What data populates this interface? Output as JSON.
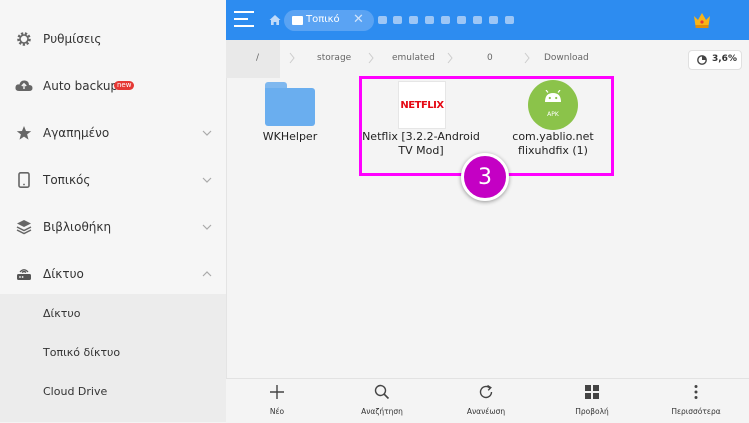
{
  "sidebar": {
    "items": [
      {
        "label": "Ρυθμίσεις"
      },
      {
        "label": "Auto backup",
        "badge": "new"
      },
      {
        "label": "Αγαπημένο"
      },
      {
        "label": "Τοπικός"
      },
      {
        "label": "Βιβλιοθήκη"
      },
      {
        "label": "Δίκτυο"
      }
    ],
    "subitems": [
      {
        "label": "Δίκτυο"
      },
      {
        "label": "Τοπικό δίκτυο"
      },
      {
        "label": "Cloud Drive"
      }
    ]
  },
  "topbar": {
    "active_tab": "Τοπικό",
    "close_glyph": "✕"
  },
  "pathbar": {
    "crumbs": [
      "/",
      "storage",
      "emulated",
      "0",
      "Download"
    ],
    "usage": "3,6%"
  },
  "files": [
    {
      "name_line1": "WKHelper",
      "name_line2": ""
    },
    {
      "name_line1": "Netflix [3.2.2-Android",
      "name_line2": "TV Mod]",
      "icon_text": "NETFLIX"
    },
    {
      "name_line1": "com.yablio.net",
      "name_line2": "flixuhdfix (1)",
      "icon_text": "APK"
    }
  ],
  "step_badge": "3",
  "bottombar": {
    "new": "Νέο",
    "search": "Αναζήτηση",
    "refresh": "Ανανέωση",
    "view": "Προβολή",
    "more": "Περισσότερα"
  },
  "colors": {
    "accent": "#2d8cf0",
    "highlight": "#ff00ff",
    "badge": "#c400c4",
    "folder": "#6aaeef",
    "android": "#8bc34a",
    "netflix": "#e50914"
  }
}
